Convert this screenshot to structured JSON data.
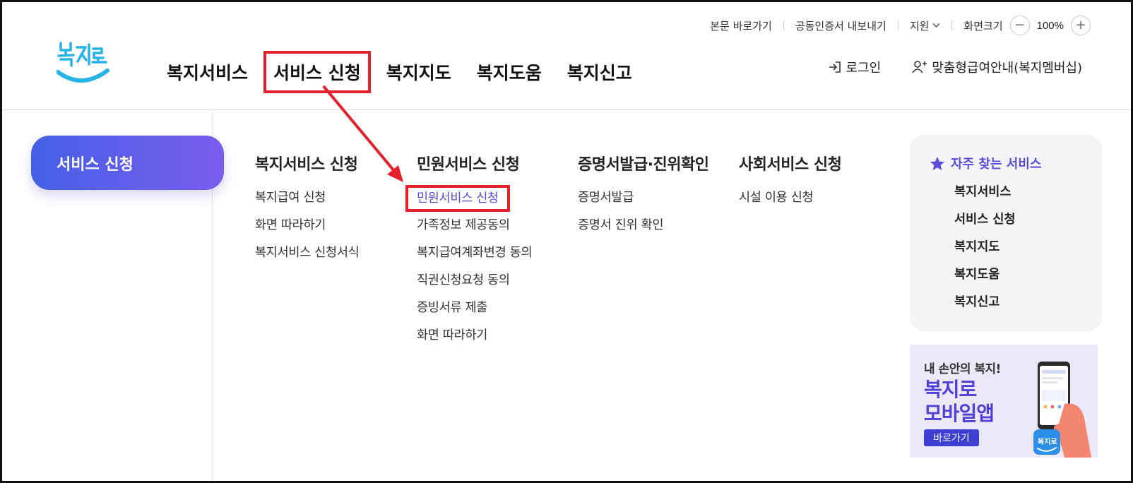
{
  "utility": {
    "skip_to_content": "본문 바로가기",
    "export_certificate": "공동인증서 내보내기",
    "support": "지원",
    "screen_size_label": "화면크기",
    "zoom_minus": "−",
    "zoom_value": "100%",
    "zoom_plus": "+"
  },
  "logo": {
    "text": "복지로",
    "icon": "bokjiro-logo"
  },
  "gnb": {
    "items": [
      {
        "label": "복지서비스"
      },
      {
        "label": "서비스 신청",
        "active": true
      },
      {
        "label": "복지지도"
      },
      {
        "label": "복지도움"
      },
      {
        "label": "복지신고"
      }
    ]
  },
  "header_right": {
    "login": "로그인",
    "login_icon": "login-arrow-icon",
    "membership": "맞춤형급여안내(복지멤버십)",
    "membership_icon": "user-plus-icon"
  },
  "side": {
    "title": "서비스 신청"
  },
  "menu": {
    "columns": [
      {
        "title": "복지서비스 신청",
        "items": [
          "복지급여 신청",
          "화면 따라하기",
          "복지서비스 신청서식"
        ]
      },
      {
        "title": "민원서비스 신청",
        "items": [
          "민원서비스 신청",
          "가족정보 제공동의",
          "복지급여계좌변경 동의",
          "직권신청요청 동의",
          "증빙서류 제출",
          "화면 따라하기"
        ],
        "active_index": 0
      },
      {
        "title": "증명서발급·진위확인",
        "items": [
          "증명서발급",
          "증명서 진위 확인"
        ]
      },
      {
        "title": "사회서비스 신청",
        "items": [
          "시설 이용 신청"
        ]
      }
    ]
  },
  "favorites": {
    "title": "자주 찾는 서비스",
    "icon": "star-icon",
    "items": [
      "복지서비스",
      "서비스 신청",
      "복지지도",
      "복지도움",
      "복지신고"
    ]
  },
  "banner": {
    "line1": "내 손안의 복지!",
    "line2": "복지로",
    "line3": "모바일앱",
    "button": "바로가기",
    "app_icon_text": "복지로"
  },
  "colors": {
    "accent": "#5b4bd8",
    "highlight_box": "#e5202a",
    "pill_gradient_start": "#4560e4",
    "pill_gradient_end": "#7a5cf0"
  }
}
